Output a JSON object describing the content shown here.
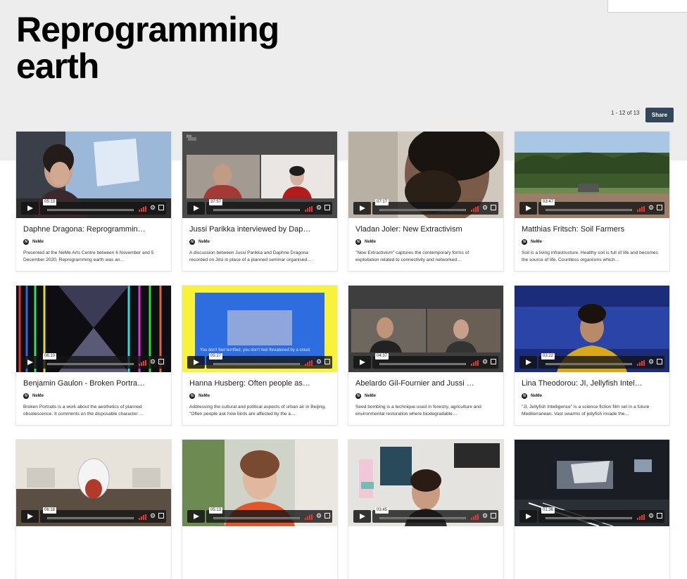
{
  "page": {
    "title": "Reprogramming earth",
    "pagination": "1 - 12 of 13",
    "share_label": "Share"
  },
  "colors": {
    "hero_background": "#ededed",
    "share_button": "#33465a",
    "volume_bars": "#e53935"
  },
  "videos": [
    {
      "title": "Daphne Dragona: Reprogrammin…",
      "duration": "05:13",
      "channel": "NeMe",
      "description": "Presented at the NeMe Arts Centre between 6 November and 5 December 2020, Reprogramming earth was an…"
    },
    {
      "title": "Jussi Parikka interviewed by Dap…",
      "duration": "37:57",
      "channel": "NeMe",
      "description": "A discussion between Jussi Parikka and Daphne Dragona recorded on Jitsi in place of a planned seminar organised…"
    },
    {
      "title": "Vladan Joler: New Extractivism",
      "duration": "07:17",
      "channel": "NeMe",
      "description": "\"New Extractivism\" captures the contemporary forms of exploitation related to connectivity and networked…"
    },
    {
      "title": "Matthias Fritsch: Soil Farmers",
      "duration": "03:47",
      "channel": "NeMe",
      "description": "Soil is a living infrastructure. Healthy soil is full of life and becomes the source of life. Countless organisms which…"
    },
    {
      "title": "Benjamin Gaulon - Broken Portra…",
      "duration": "06:10",
      "channel": "NeMe",
      "description": "Broken Portraits is a work about the aesthetics of planned obsolescence. It comments on the disposable character …"
    },
    {
      "title": "Hanna Husberg: Often people as…",
      "duration": "05:27",
      "channel": "NeMe",
      "description": "Addressing the cultural and political aspects of urban air in Beijing, \"Often people ask how birds are affected by the a…"
    },
    {
      "title": "Abelardo Gil-Fournier and Jussi …",
      "duration": "04:37",
      "channel": "NeMe",
      "description": "Seed bombing is a technique used in forestry, agriculture and environmental restoration where biodegradable…"
    },
    {
      "title": "Lina Theodorou: JI, Jellyfish Intel…",
      "duration": "03:22",
      "channel": "NeMe",
      "description": "\"JI, Jellyfish Intelligence\" is a science fiction film set in a future Mediterranean. Vast swarms of jellyfish invade the…"
    },
    {
      "title": "",
      "duration": "06:18",
      "channel": "",
      "description": ""
    },
    {
      "title": "",
      "duration": "05:13",
      "channel": "",
      "description": ""
    },
    {
      "title": "",
      "duration": "03:45",
      "channel": "",
      "description": ""
    },
    {
      "title": "",
      "duration": "01:36",
      "channel": "",
      "description": ""
    }
  ],
  "thumbnails": [
    {
      "icon": "presenter-projection-scene"
    },
    {
      "icon": "jitsi-call-scene",
      "overlay_text": "jitsi"
    },
    {
      "icon": "closeup-face-scene"
    },
    {
      "icon": "field-forest-scene"
    },
    {
      "icon": "glitch-tunnel-scene"
    },
    {
      "icon": "blue-screen-scene",
      "overlay_text": "You don't feel terrified, you don't feel threatened by a cloud."
    },
    {
      "icon": "video-call-two-people-scene"
    },
    {
      "icon": "woman-blue-backdrop-scene"
    },
    {
      "icon": "glass-jar-table-scene"
    },
    {
      "icon": "woman-window-scene"
    },
    {
      "icon": "woman-wall-art-scene"
    },
    {
      "icon": "dark-gallery-scene"
    }
  ]
}
